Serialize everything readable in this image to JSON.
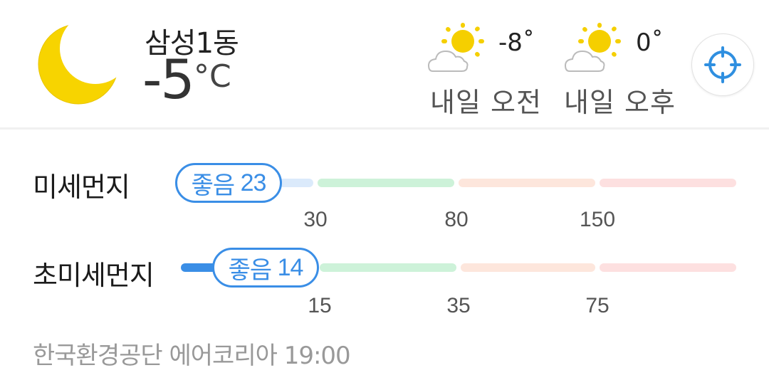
{
  "current": {
    "location": "삼성1동",
    "temperature": "-5",
    "unit": "°C",
    "icon": "moon-icon"
  },
  "forecast": [
    {
      "temp": "-8˚",
      "label": "내일 오전",
      "icon": "partly-sunny-icon"
    },
    {
      "temp": "0˚",
      "label": "내일 오후",
      "icon": "partly-sunny-icon"
    }
  ],
  "locate_button": {
    "icon": "crosshair-icon"
  },
  "fine_dust": {
    "label": "미세먼지",
    "grade": "좋음",
    "value": "23",
    "ticks": [
      "30",
      "80",
      "150"
    ]
  },
  "ultrafine_dust": {
    "label": "초미세먼지",
    "grade": "좋음",
    "value": "14",
    "ticks": [
      "15",
      "35",
      "75"
    ]
  },
  "source": "한국환경공단 에어코리아 19:00",
  "colors": {
    "good": "#dbeafb",
    "normal": "#cdf2d9",
    "bad": "#fde6dc",
    "very_bad": "#fde0e0",
    "accent": "#3a8ee6",
    "moon": "#f5d100"
  }
}
